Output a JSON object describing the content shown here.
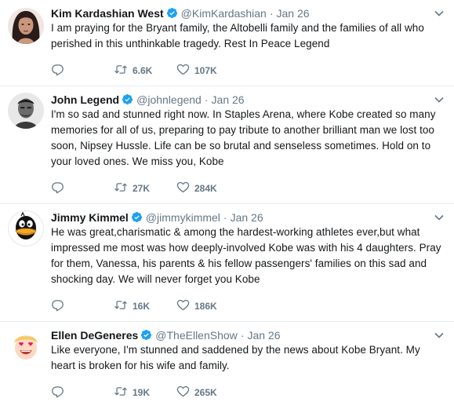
{
  "colors": {
    "verified": "#1da1f2",
    "secondary_text": "#657786",
    "primary_text": "#14171a",
    "divider": "#e6ecf0"
  },
  "tweets": [
    {
      "name": "Kim Kardashian West",
      "handle": "@KimKardashian",
      "separator": "·",
      "date": "Jan 26",
      "text": "I am praying for the Bryant family, the Altobelli family and the families of all who perished in this unthinkable tragedy. Rest In Peace Legend",
      "reply_count": "",
      "retweet_count": "6.6K",
      "like_count": "107K",
      "avatar_icon": "profile-photo"
    },
    {
      "name": "John Legend",
      "handle": "@johnlegend",
      "separator": "·",
      "date": "Jan 26",
      "text": "I'm so sad and stunned right now. In Staples Arena, where Kobe created so many memories for all of us, preparing to pay tribute to another brilliant man we lost too soon, Nipsey Hussle.  Life can be so brutal and senseless sometimes. Hold on to your loved ones. We miss you, Kobe",
      "reply_count": "",
      "retweet_count": "27K",
      "like_count": "284K",
      "avatar_icon": "profile-photo"
    },
    {
      "name": "Jimmy Kimmel",
      "handle": "@jimmykimmel",
      "separator": "·",
      "date": "Jan 26",
      "text": "He was great,charismatic & among the hardest-working athletes ever,but what impressed me most was how deeply-involved Kobe was with his 4 daughters. Pray for them, Vanessa, his parents & his fellow passengers' families on this sad and shocking day.   We will never forget you Kobe",
      "reply_count": "",
      "retweet_count": "16K",
      "like_count": "186K",
      "avatar_icon": "duck-cartoon"
    },
    {
      "name": "Ellen DeGeneres",
      "handle": "@TheEllenShow",
      "separator": "·",
      "date": "Jan 26",
      "text": "Like everyone, I'm stunned and saddened by the news about Kobe Bryant. My heart is broken for his wife and family.",
      "reply_count": "",
      "retweet_count": "19K",
      "like_count": "265K",
      "avatar_icon": "cartoon-face-heart-eyes"
    }
  ]
}
